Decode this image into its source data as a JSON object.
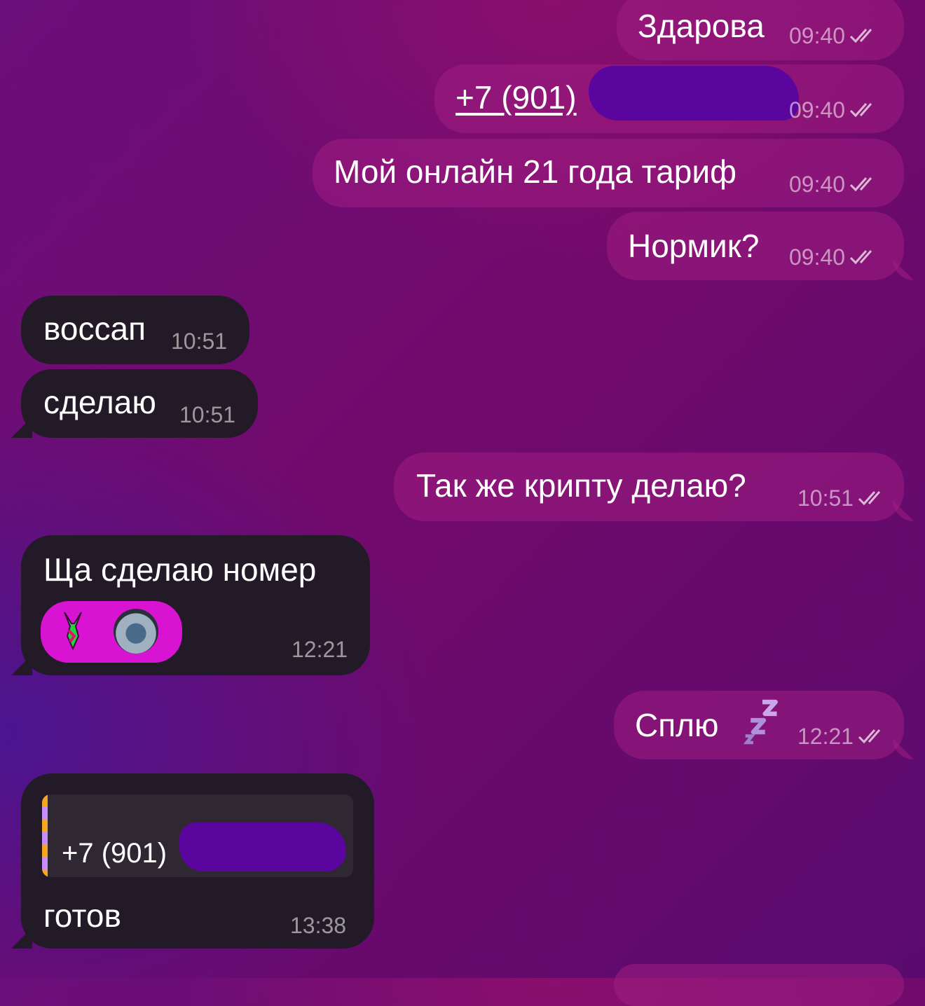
{
  "colors": {
    "outgoing_bubble": "#a01e82",
    "incoming_bubble": "#221a26",
    "redaction": "#5a069e",
    "reaction_pill": "#d814d2"
  },
  "messages": [
    {
      "text": "Здарова",
      "time": "09:40",
      "read": true
    },
    {
      "text": "+7 (901)",
      "time": "09:40",
      "read": true,
      "is_link": true
    },
    {
      "text": "Мой онлайн 21 года тариф",
      "time": "09:40",
      "read": true
    },
    {
      "text": "Нормик?",
      "time": "09:40",
      "read": true
    },
    {
      "text": "воссап",
      "time": "10:51"
    },
    {
      "text": "сделаю",
      "time": "10:51"
    },
    {
      "text": "Так же крипту делаю?",
      "time": "10:51",
      "read": true
    },
    {
      "text": "Ща сделаю номер",
      "time": "12:21",
      "reactions": [
        "bunny-sticker-icon",
        "avatar-icon"
      ]
    },
    {
      "text": "Сплю",
      "time": "12:21",
      "read": true,
      "emoji": "sleep-zzz-icon"
    },
    {
      "quote": "+7 (901)",
      "text": "готов",
      "time": "13:38"
    }
  ]
}
